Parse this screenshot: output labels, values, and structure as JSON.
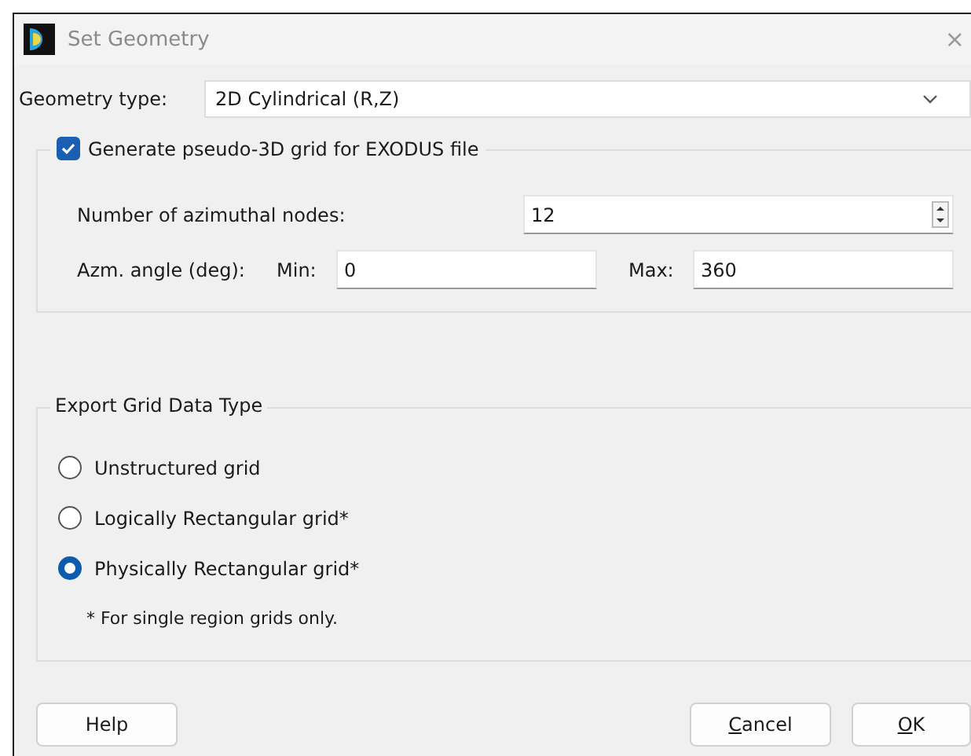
{
  "window": {
    "title": "Set Geometry",
    "close": "×"
  },
  "geometry_type": {
    "label": "Geometry type:",
    "value": "2D Cylindrical (R,Z)"
  },
  "pseudo3d": {
    "label": "Generate pseudo-3D grid for EXODUS file",
    "checked": true,
    "nodes": {
      "label": "Number of azimuthal nodes:",
      "value": "12"
    },
    "angle": {
      "label": "Azm. angle (deg):",
      "min_label": "Min:",
      "min": "0",
      "max_label": "Max:",
      "max": "360"
    }
  },
  "export": {
    "title": "Export Grid Data Type",
    "options": [
      {
        "label": "Unstructured grid",
        "selected": false
      },
      {
        "label": "Logically Rectangular grid*",
        "selected": false
      },
      {
        "label": "Physically Rectangular grid*",
        "selected": true
      }
    ],
    "note": "* For single region grids only."
  },
  "buttons": [
    {
      "label": "Help",
      "mnemonic": false
    },
    {
      "label": "Cancel",
      "mnemonic": true
    },
    {
      "label": "OK",
      "mnemonic": true
    }
  ]
}
